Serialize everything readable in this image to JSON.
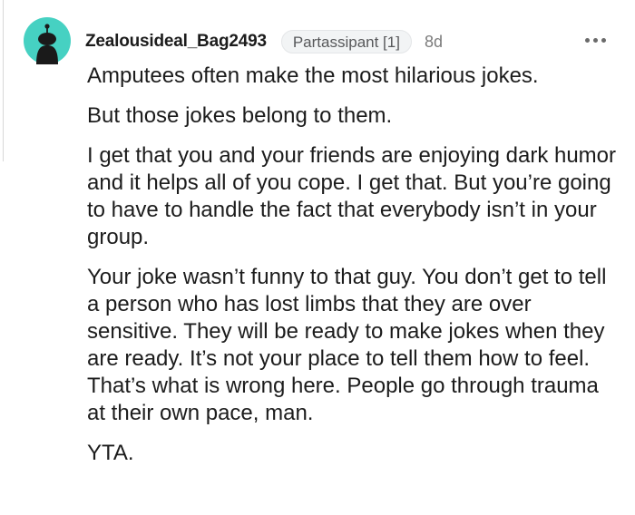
{
  "comment": {
    "author": "Zealousideal_Bag2493",
    "flair": "Partassipant [1]",
    "age": "8d",
    "avatar_icon": "reddit-snoo-avatar-icon",
    "more_icon": "more-options-icon",
    "paragraphs": [
      "Amputees often make the most hilarious jokes.",
      "But those jokes belong to them.",
      "I get that you and your friends are enjoying dark humor and it helps all of you cope. I get that. But you’re going to have to handle the fact that everybody isn’t in your group.",
      "Your joke wasn’t funny to that guy. You don’t get to tell a person who has lost limbs that they are over sensitive. They will be ready to make jokes when they are ready. It’s not your place to tell them how to feel. That’s what is wrong here. People go through trauma at their own pace, man.",
      "YTA."
    ]
  },
  "colors": {
    "avatar_bg": "#46D1C2",
    "avatar_figure": "#1a1a1a",
    "text": "#1c1c1c",
    "meta": "#7c7c7c"
  }
}
